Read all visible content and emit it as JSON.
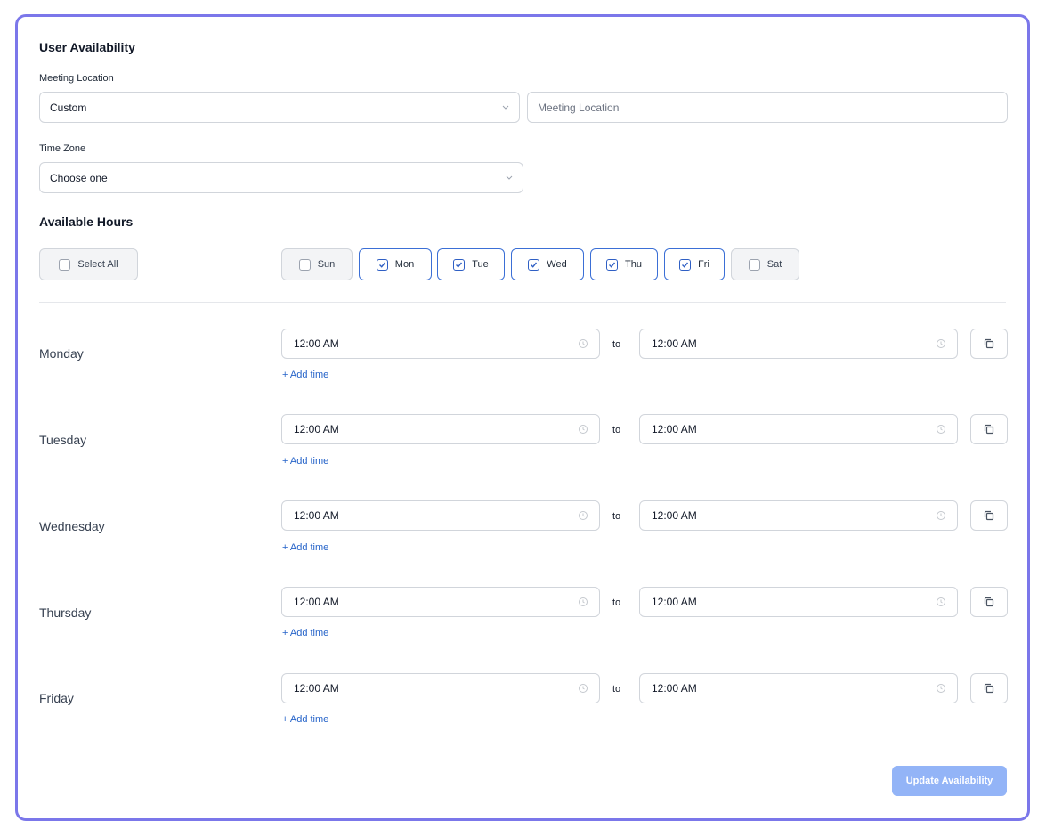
{
  "form": {
    "title": "User Availability",
    "meeting_location": {
      "label": "Meeting Location",
      "type_value": "Custom",
      "text_placeholder": "Meeting Location"
    },
    "time_zone": {
      "label": "Time Zone",
      "value": "Choose one"
    },
    "available_hours": {
      "title": "Available Hours",
      "select_all_label": "Select All",
      "days": [
        {
          "label": "Sun",
          "checked": false
        },
        {
          "label": "Mon",
          "checked": true
        },
        {
          "label": "Tue",
          "checked": true
        },
        {
          "label": "Wed",
          "checked": true
        },
        {
          "label": "Thu",
          "checked": true
        },
        {
          "label": "Fri",
          "checked": true
        },
        {
          "label": "Sat",
          "checked": false
        }
      ]
    },
    "schedule": [
      {
        "day": "Monday",
        "from": "12:00 AM",
        "separator": "to",
        "until": "12:00 AM",
        "add_time": "+ Add time"
      },
      {
        "day": "Tuesday",
        "from": "12:00 AM",
        "separator": "to",
        "until": "12:00 AM",
        "add_time": "+ Add time"
      },
      {
        "day": "Wednesday",
        "from": "12:00 AM",
        "separator": "to",
        "until": "12:00 AM",
        "add_time": "+ Add time"
      },
      {
        "day": "Thursday",
        "from": "12:00 AM",
        "separator": "to",
        "until": "12:00 AM",
        "add_time": "+ Add time"
      },
      {
        "day": "Friday",
        "from": "12:00 AM",
        "separator": "to",
        "until": "12:00 AM",
        "add_time": "+ Add time"
      }
    ],
    "update_button": "Update Availability"
  },
  "colors": {
    "frame_border": "#7b77ea",
    "accent": "#2f5fc4",
    "link": "#2563c9",
    "button_disabled": "#93b4f7"
  },
  "icons": {
    "select": "chevron-down-icon",
    "time": "clock-icon",
    "copy": "copy-icon",
    "checkbox": "checkmark-icon"
  }
}
